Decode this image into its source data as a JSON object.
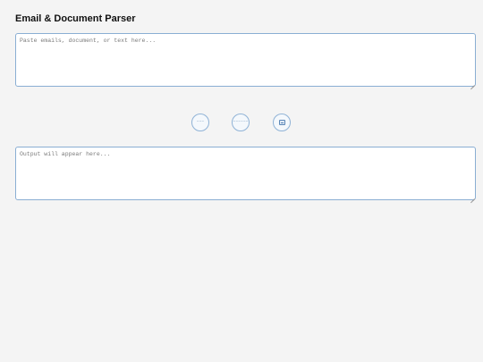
{
  "header": {
    "title": "Email & Document Parser"
  },
  "input": {
    "placeholder": "Paste emails, document, or text here...",
    "value": ""
  },
  "output": {
    "placeholder": "Output will appear here...",
    "value": ""
  },
  "actions": [
    {
      "label": "~~~",
      "icon": "short-wave-icon"
    },
    {
      "label": "~~~~~~",
      "icon": "long-wave-icon"
    },
    {
      "label": "",
      "icon": "clipboard-icon"
    }
  ],
  "colors": {
    "background": "#f4f4f4",
    "border_accent": "#8aaed3",
    "button_accent": "#4a78a8"
  }
}
